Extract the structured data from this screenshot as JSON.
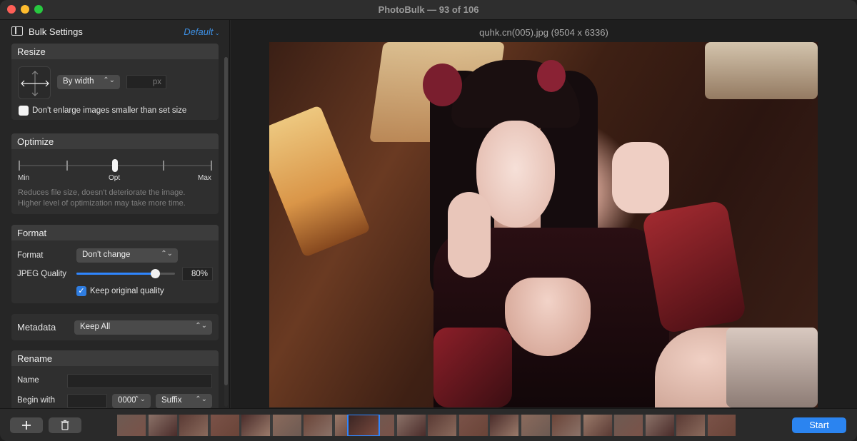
{
  "window": {
    "title": "PhotoBulk — 93 of 106"
  },
  "sidebar": {
    "title": "Bulk Settings",
    "preset": "Default",
    "resize": {
      "header": "Resize",
      "mode": "By width",
      "size_value": "",
      "size_unit": "px",
      "dont_enlarge_label": "Don't enlarge images smaller than set size",
      "dont_enlarge_checked": false
    },
    "optimize": {
      "header": "Optimize",
      "level": "Opt",
      "labels": {
        "min": "Min",
        "opt": "Opt",
        "max": "Max"
      },
      "description": "Reduces file size, doesn't deteriorate the image.",
      "description2": "Higher level of optimization may take more time."
    },
    "format": {
      "header": "Format",
      "format_label": "Format",
      "format_value": "Don't change",
      "quality_label": "JPEG Quality",
      "quality_value": "80%",
      "quality_fraction": 0.8,
      "keep_quality_label": "Keep original quality",
      "keep_quality_checked": true
    },
    "metadata": {
      "label": "Metadata",
      "value": "Keep All"
    },
    "rename": {
      "header": "Rename",
      "name_label": "Name",
      "name_value": "",
      "begin_label": "Begin with",
      "begin_value": "",
      "counter_value": "0000",
      "position_value": "Suffix"
    }
  },
  "preview": {
    "filename": "quhk.cn(005).jpg (9504 x 6336)"
  },
  "bottom": {
    "add_icon": "plus-icon",
    "delete_icon": "trash-icon",
    "start_label": "Start"
  },
  "colors": {
    "accent": "#2b84f0",
    "preset_link": "#3d8fe3",
    "selection_border": "#2f86ff"
  }
}
